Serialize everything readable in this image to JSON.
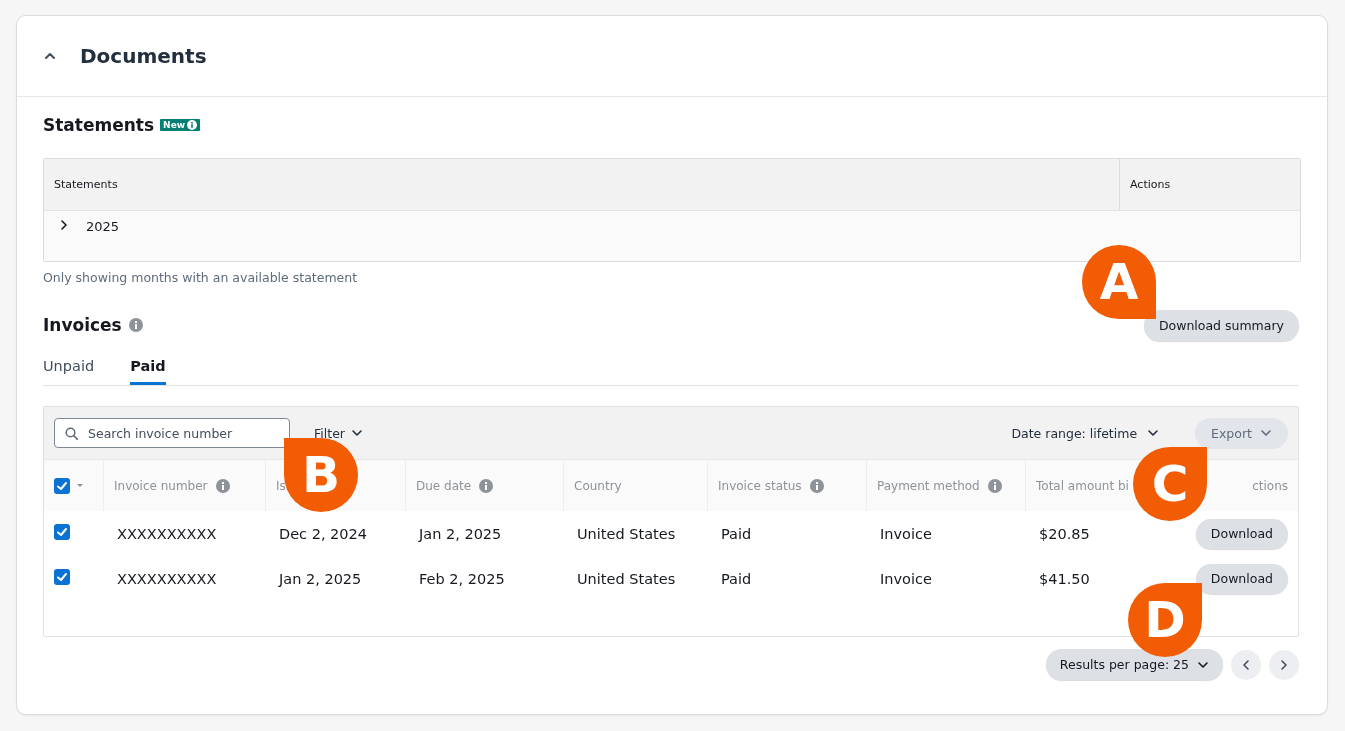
{
  "panel": {
    "title": "Documents",
    "expanded": true
  },
  "statements": {
    "title": "Statements",
    "badge": "New",
    "columns": [
      "Statements",
      "Actions"
    ],
    "rows": [
      {
        "label": "2025",
        "expanded": false
      }
    ],
    "note": "Only showing months with an available statement"
  },
  "invoices": {
    "title": "Invoices",
    "download_button": "Download summary",
    "tabs": [
      {
        "label": "Unpaid",
        "selected": false
      },
      {
        "label": "Paid",
        "selected": true
      }
    ],
    "search": {
      "placeholder": "Search invoice number"
    },
    "filter": "Filter",
    "date_range": "Date range: lifetime",
    "export": "Export",
    "select_all": {
      "checked": true
    },
    "columns": [
      {
        "label": "Invoice number",
        "info": true
      },
      {
        "label": "Is"
      },
      {
        "label": "Due date",
        "info": true
      },
      {
        "label": "Country"
      },
      {
        "label": "Invoice status",
        "info": true
      },
      {
        "label": "Payment method",
        "info": true
      },
      {
        "label": "Total amount bi"
      },
      {
        "label": "ctions"
      }
    ],
    "rows": [
      {
        "checked": true,
        "cells": [
          "XXXXXXXXXX",
          "Dec 2, 2024",
          "Jan 2, 2025",
          "United States",
          "Paid",
          "Invoice",
          "$20.85"
        ],
        "action": "Download"
      },
      {
        "checked": true,
        "cells": [
          "XXXXXXXXXX",
          "Jan 2, 2025",
          "Feb 2, 2025",
          "United States",
          "Paid",
          "Invoice",
          "$41.50"
        ],
        "action": "Download"
      }
    ],
    "pagination": {
      "results_per_page": "Results per page: 25"
    }
  },
  "callouts": [
    {
      "label": "A",
      "kind": "bottom-right"
    },
    {
      "label": "B",
      "kind": "top-left"
    },
    {
      "label": "C",
      "kind": "top-right"
    },
    {
      "label": "D",
      "kind": "top-right"
    }
  ]
}
